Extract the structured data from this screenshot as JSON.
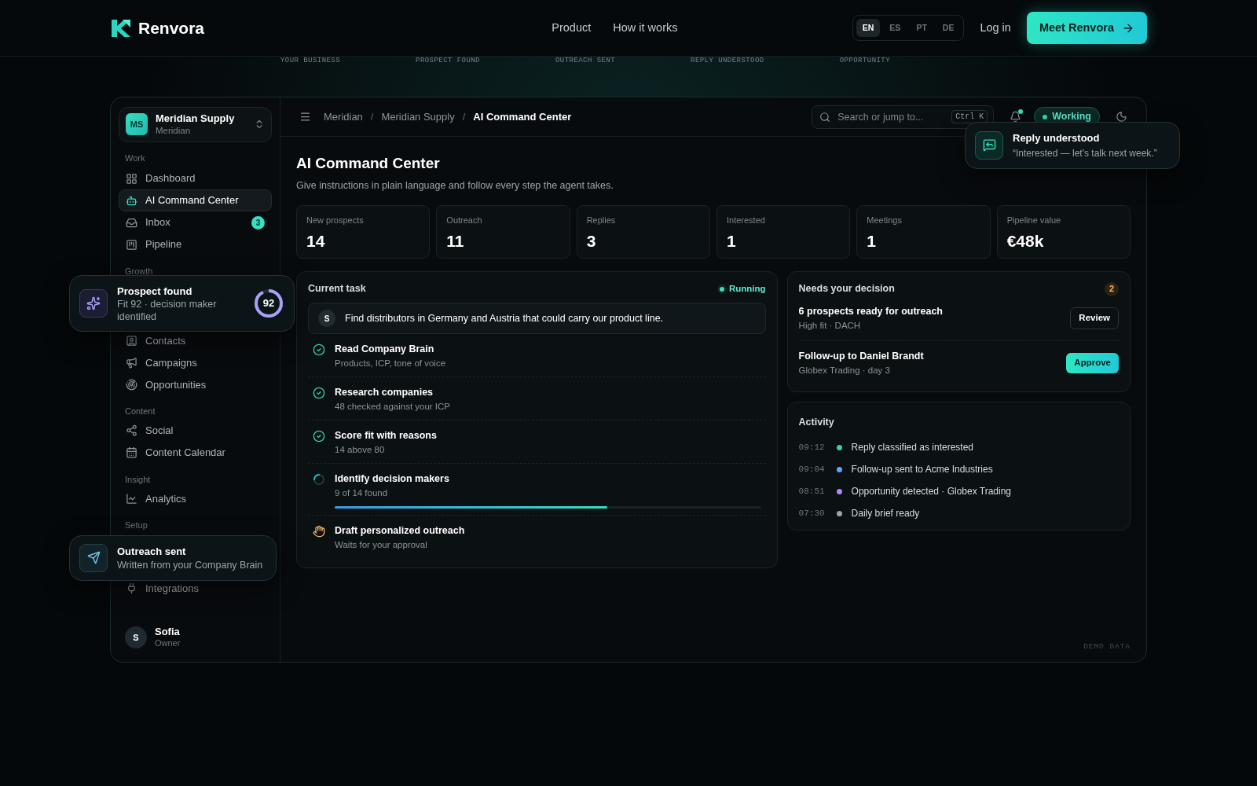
{
  "brand": {
    "name": "Renvora"
  },
  "nav": [
    {
      "label": "Product"
    },
    {
      "label": "How it works"
    }
  ],
  "languages": [
    {
      "code": "EN",
      "selected": true
    },
    {
      "code": "ES",
      "selected": false
    },
    {
      "code": "PT",
      "selected": false
    },
    {
      "code": "DE",
      "selected": false
    }
  ],
  "login": "Log in",
  "cta": "Meet Renvora",
  "steps_strip": [
    "YOUR BUSINESS",
    "PROSPECT FOUND",
    "OUTREACH SENT",
    "REPLY UNDERSTOOD",
    "OPPORTUNITY"
  ],
  "workspace": {
    "initials": "MS",
    "name": "Meridian Supply",
    "subtitle": "Meridian"
  },
  "sidebar": {
    "sections": [
      {
        "label": "Work",
        "items": [
          {
            "label": "Dashboard",
            "selected": false
          },
          {
            "label": "AI Command Center",
            "selected": true
          },
          {
            "label": "Inbox",
            "selected": false,
            "badge": "3"
          },
          {
            "label": "Pipeline",
            "selected": false
          }
        ]
      },
      {
        "label": "Growth",
        "items": [
          {
            "label": "Contacts",
            "selected": false
          },
          {
            "label": "Campaigns",
            "selected": false
          },
          {
            "label": "Opportunities",
            "selected": false
          }
        ]
      },
      {
        "label": "Content",
        "items": [
          {
            "label": "Social",
            "selected": false
          },
          {
            "label": "Content Calendar",
            "selected": false
          }
        ]
      },
      {
        "label": "Insight",
        "items": [
          {
            "label": "Analytics",
            "selected": false
          }
        ]
      },
      {
        "label": "Setup",
        "items": [
          {
            "label": "Integrations",
            "selected": false
          }
        ]
      }
    ]
  },
  "user": {
    "initials": "S",
    "name": "Sofia",
    "role": "Owner"
  },
  "floating_cards": [
    {
      "kind": "score",
      "title": "Prospect found",
      "text": "Fit 92 · decision maker identified",
      "score": "92",
      "level": 0.92
    },
    {
      "kind": "plain",
      "title": "Outreach sent",
      "text": "Written from your Company Brain"
    }
  ],
  "topbar": {
    "separator": "/",
    "breadcrumbs": [
      "Meridian",
      "Meridian Supply",
      "AI Command Center"
    ],
    "search_placeholder": "Search or jump to...",
    "shortcut": "Ctrl K",
    "unread": true,
    "status": "Working"
  },
  "toast": {
    "title": "Reply understood",
    "text": "“Interested — let's talk next week.”"
  },
  "page": {
    "title": "AI Command Center",
    "subtitle": "Give instructions in plain language and follow every step the agent takes."
  },
  "stats": [
    {
      "label": "New prospects",
      "value": "14"
    },
    {
      "label": "Outreach",
      "value": "11"
    },
    {
      "label": "Replies",
      "value": "3"
    },
    {
      "label": "Interested",
      "value": "1"
    },
    {
      "label": "Meetings",
      "value": "1"
    },
    {
      "label": "Pipeline value",
      "value": "€48k"
    }
  ],
  "current_task": {
    "title": "Current task",
    "status": "Running",
    "prompt": {
      "initials": "S",
      "text": "Find distributors in Germany and Austria that could carry our product line."
    },
    "steps": [
      {
        "kind": "done",
        "title": "Read Company Brain",
        "detail": "Products, ICP, tone of voice"
      },
      {
        "kind": "done",
        "title": "Research companies",
        "detail": "48 checked against your ICP"
      },
      {
        "kind": "done",
        "title": "Score fit with reasons",
        "detail": "14 above 80"
      },
      {
        "kind": "running",
        "title": "Identify decision makers",
        "detail": "9 of 14 found",
        "level": 0.64
      },
      {
        "kind": "waiting",
        "title": "Draft personalized outreach",
        "detail": "Waits for your approval"
      }
    ]
  },
  "decisions": {
    "title": "Needs your decision",
    "count": "2",
    "items": [
      {
        "title": "6 prospects ready for outreach",
        "detail": "High fit · DACH",
        "action": {
          "label": "Review",
          "kind": "outline"
        }
      },
      {
        "title": "Follow-up to Daniel Brandt",
        "detail": "Globex Trading · day 3",
        "action": {
          "label": "Approve",
          "kind": "primary"
        }
      }
    ]
  },
  "activity": {
    "title": "Activity",
    "items": [
      {
        "time": "09:12",
        "text": "Reply classified as interested",
        "color": "#34d399"
      },
      {
        "time": "09:04",
        "text": "Follow-up sent to Acme Industries",
        "color": "#60a5fa"
      },
      {
        "time": "08:51",
        "text": "Opportunity detected · Globex Trading",
        "color": "#a78bfa"
      },
      {
        "time": "07:30",
        "text": "Daily brief ready",
        "color": "#9ca3af"
      }
    ]
  },
  "footer_note": "DEMO DATA"
}
